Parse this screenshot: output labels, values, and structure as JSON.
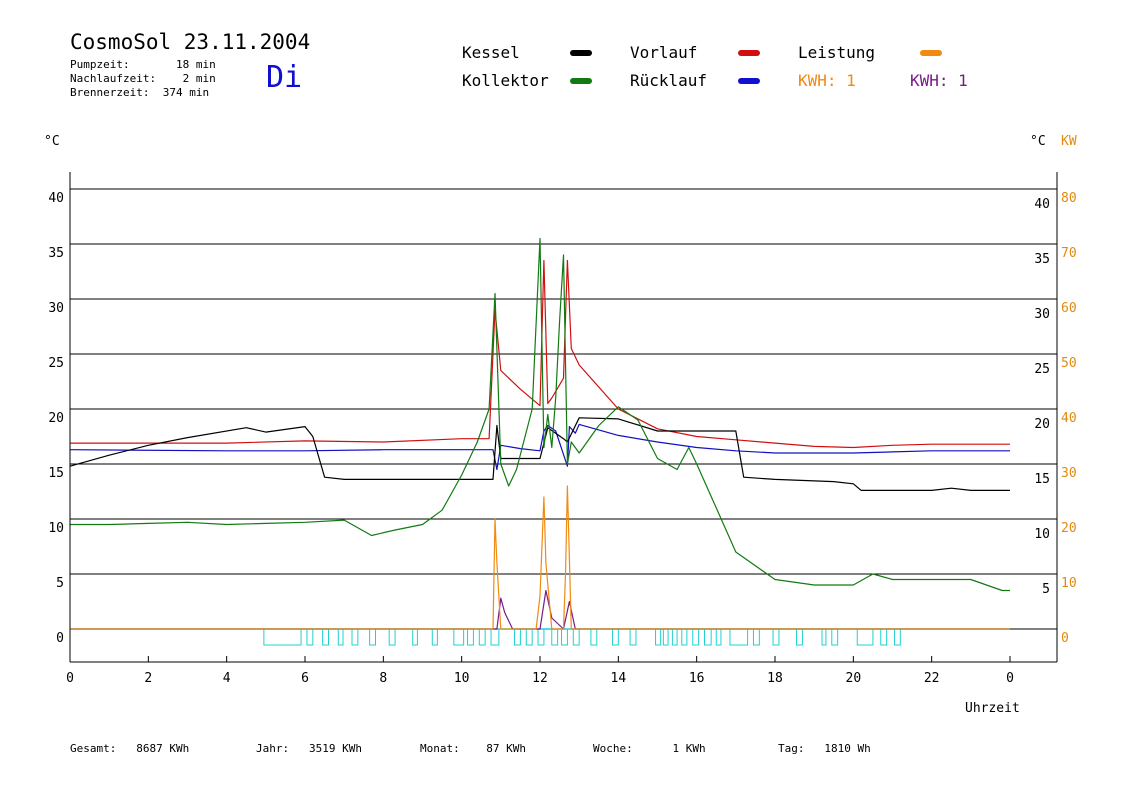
{
  "header": {
    "title": "CosmoSol 23.11.2004",
    "weekday": "Di",
    "pumpzeit": "Pumpzeit:       18 min",
    "nachlaufzeit": "Nachlaufzeit:    2 min",
    "brennerzeit": "Brennerzeit:  374 min"
  },
  "legend": {
    "kessel": "Kessel",
    "kollektor": "Kollektor",
    "vorlauf": "Vorlauf",
    "ruecklauf": "Rücklauf",
    "leistung": "Leistung",
    "kwh1": "KWH: 1",
    "kwh2": "KWH: 1"
  },
  "colors": {
    "kessel": "#000000",
    "kollektor": "#127a12",
    "vorlauf": "#d01010",
    "ruecklauf": "#1010c0",
    "leistung": "#f08a10",
    "kwh2": "#7a1a8a",
    "pump": "#20d0d0",
    "kw_axis": "#e08a10"
  },
  "axes": {
    "left_unit": "°C",
    "right_unit": "°C",
    "kw_unit": "KW",
    "xlabel": "Uhrzeit"
  },
  "footer": {
    "gesamt": "Gesamt:   8687 KWh",
    "jahr": "Jahr:   3519 KWh",
    "monat": "Monat:    87 KWh",
    "woche": "Woche:      1 KWh",
    "tag": "Tag:   1810 Wh"
  },
  "chart_data": {
    "type": "line",
    "xlim": [
      0,
      24
    ],
    "ylim": [
      -3,
      44
    ],
    "y2lim": [
      -6,
      88
    ],
    "grid": true,
    "x_ticks": [
      "0",
      "2",
      "4",
      "6",
      "8",
      "10",
      "12",
      "14",
      "16",
      "18",
      "20",
      "22",
      "0"
    ],
    "y_ticks_left": [
      "0",
      "5",
      "10",
      "15",
      "20",
      "25",
      "30",
      "35",
      "40"
    ],
    "y_ticks_right": [
      "5",
      "10",
      "15",
      "20",
      "25",
      "30",
      "35",
      "40"
    ],
    "y_ticks_kw": [
      "0",
      "10",
      "20",
      "30",
      "40",
      "50",
      "60",
      "70",
      "80"
    ],
    "series": [
      {
        "name": "Kessel",
        "x": [
          0,
          1,
          2,
          3,
          4.5,
          5,
          6,
          6.2,
          6.5,
          7,
          9,
          10,
          10.8,
          10.9,
          11,
          12,
          12.2,
          12.4,
          12.6,
          12.7,
          13,
          14,
          15,
          17,
          17.2,
          18,
          19.5,
          20,
          20.2,
          21,
          22,
          22.5,
          23,
          24
        ],
        "values": [
          14.8,
          15.8,
          16.7,
          17.4,
          18.3,
          17.9,
          18.4,
          17.5,
          13.8,
          13.6,
          13.6,
          13.6,
          13.6,
          18.5,
          15.5,
          15.5,
          18.3,
          17.8,
          17.3,
          17.0,
          19.2,
          19.1,
          18.0,
          18.0,
          13.8,
          13.6,
          13.4,
          13.2,
          12.6,
          12.6,
          12.6,
          12.8,
          12.6,
          12.6
        ]
      },
      {
        "name": "Kollektor",
        "x": [
          0,
          1,
          2,
          3,
          4,
          5,
          6,
          7,
          7.7,
          8.3,
          9,
          9.5,
          10,
          10.4,
          10.7,
          10.85,
          11,
          11.2,
          11.4,
          11.8,
          12,
          12.1,
          12.2,
          12.3,
          12.4,
          12.5,
          12.6,
          12.7,
          12.8,
          13,
          13.5,
          14,
          14.5,
          15,
          15.5,
          15.8,
          16,
          16.5,
          17,
          18,
          19,
          20,
          20.5,
          21,
          22,
          23,
          23.8,
          24
        ],
        "values": [
          9.5,
          9.5,
          9.6,
          9.7,
          9.5,
          9.6,
          9.7,
          9.9,
          8.5,
          9.0,
          9.5,
          10.8,
          14.0,
          17.0,
          20.0,
          30.5,
          15.0,
          13.0,
          14.5,
          20.0,
          35.5,
          16.5,
          19.5,
          16.5,
          21.0,
          28.0,
          34.0,
          15.0,
          17.0,
          16.0,
          18.5,
          20.2,
          19.0,
          15.5,
          14.5,
          16.5,
          15.0,
          11.0,
          7.0,
          4.5,
          4.0,
          4.0,
          5.0,
          4.5,
          4.5,
          4.5,
          3.5,
          3.5
        ]
      },
      {
        "name": "Vorlauf",
        "x": [
          0,
          1,
          2,
          4,
          6,
          8,
          10,
          10.7,
          10.85,
          11,
          11.5,
          12,
          12.1,
          12.2,
          12.3,
          12.5,
          12.6,
          12.7,
          12.8,
          13,
          14,
          15,
          16,
          17,
          18,
          19,
          20,
          21,
          22,
          23,
          24
        ],
        "values": [
          16.9,
          16.9,
          16.9,
          16.9,
          17.1,
          17.0,
          17.3,
          17.3,
          29.0,
          23.5,
          21.8,
          20.3,
          33.5,
          20.5,
          21.0,
          22.2,
          22.8,
          33.5,
          25.5,
          24.0,
          20.0,
          18.2,
          17.5,
          17.2,
          16.9,
          16.6,
          16.5,
          16.7,
          16.8,
          16.8,
          16.8
        ]
      },
      {
        "name": "Rücklauf",
        "x": [
          0,
          4,
          6,
          8,
          10,
          10.8,
          10.9,
          11,
          11.5,
          12,
          12.1,
          12.2,
          12.4,
          12.7,
          12.75,
          12.9,
          13,
          14,
          15,
          16,
          17,
          18,
          19,
          20,
          21,
          22,
          23,
          24
        ],
        "values": [
          16.3,
          16.2,
          16.2,
          16.3,
          16.3,
          16.3,
          14.5,
          16.7,
          16.4,
          16.2,
          18.0,
          18.5,
          18.0,
          14.8,
          18.4,
          17.8,
          18.6,
          17.6,
          17.0,
          16.5,
          16.2,
          16.0,
          16.0,
          16.0,
          16.1,
          16.2,
          16.2,
          16.2
        ]
      },
      {
        "name": "Leistung",
        "x": [
          0,
          10.7,
          10.8,
          10.85,
          10.9,
          11,
          11.5,
          11.9,
          12,
          12.1,
          12.15,
          12.3,
          12.5,
          12.6,
          12.65,
          12.7,
          12.8,
          24
        ],
        "values": [
          0,
          0,
          0,
          10,
          6,
          0,
          0,
          0,
          3,
          12,
          6,
          0,
          0,
          0,
          5,
          13,
          0,
          0
        ]
      },
      {
        "name": "KWH",
        "x": [
          0,
          10.9,
          11.0,
          11.1,
          11.3,
          12.0,
          12.15,
          12.3,
          12.6,
          12.75,
          12.9,
          24
        ],
        "values": [
          0,
          0,
          2.8,
          1.5,
          0,
          0,
          3.5,
          1.0,
          0,
          2.5,
          0,
          0
        ]
      }
    ],
    "pump_blocks": [
      [
        4.95,
        5.9
      ],
      [
        6.05,
        6.2
      ],
      [
        6.45,
        6.6
      ],
      [
        6.85,
        6.97
      ],
      [
        7.2,
        7.35
      ],
      [
        7.65,
        7.8
      ],
      [
        8.15,
        8.3
      ],
      [
        8.75,
        8.87
      ],
      [
        9.25,
        9.38
      ],
      [
        9.8,
        10.05
      ],
      [
        10.15,
        10.3
      ],
      [
        10.45,
        10.6
      ],
      [
        10.75,
        10.95
      ],
      [
        11.35,
        11.5
      ],
      [
        11.65,
        11.8
      ],
      [
        11.95,
        12.1
      ],
      [
        12.3,
        12.45
      ],
      [
        12.55,
        12.7
      ],
      [
        12.85,
        13
      ],
      [
        13.3,
        13.45
      ],
      [
        13.85,
        14
      ],
      [
        14.3,
        14.45
      ],
      [
        14.95,
        15.08
      ],
      [
        15.15,
        15.27
      ],
      [
        15.38,
        15.5
      ],
      [
        15.62,
        15.75
      ],
      [
        15.9,
        16.05
      ],
      [
        16.2,
        16.37
      ],
      [
        16.5,
        16.62
      ],
      [
        16.85,
        17.3
      ],
      [
        17.45,
        17.6
      ],
      [
        17.95,
        18.1
      ],
      [
        18.55,
        18.7
      ],
      [
        19.2,
        19.3
      ],
      [
        19.45,
        19.6
      ],
      [
        20.1,
        20.5
      ],
      [
        20.7,
        20.85
      ],
      [
        21.05,
        21.2
      ]
    ]
  }
}
